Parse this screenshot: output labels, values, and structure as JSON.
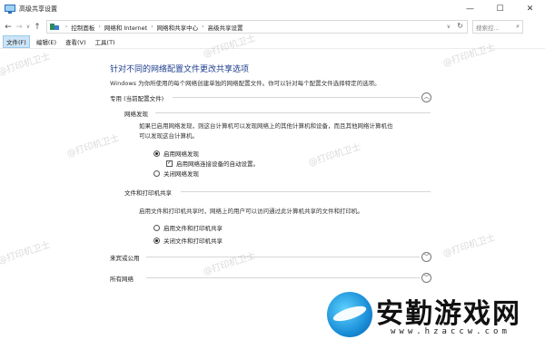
{
  "window": {
    "title": "高级共享设置",
    "controls": {
      "minimize": "—",
      "maximize": "☐",
      "close": "✕"
    }
  },
  "address_bar": {
    "back": "←",
    "forward": "→",
    "dropdown": "∨",
    "up": "↑",
    "crumbs": [
      "控制面板",
      "网络和 Internet",
      "网络和共享中心",
      "高级共享设置"
    ],
    "separator": "›",
    "refresh": "↻",
    "search_placeholder": "搜索控...",
    "search_icon": "⌕"
  },
  "menu": [
    "文件(F)",
    "编辑(E)",
    "查看(V)",
    "工具(T)"
  ],
  "main": {
    "title": "针对不同的网络配置文件更改共享选项",
    "description": "Windows 为你所使用的每个网络创建单独的网络配置文件。你可以针对每个配置文件选择特定的选项。"
  },
  "profiles": [
    {
      "label": "专用 (当前配置文件)",
      "expanded": true,
      "chevron": "︿"
    },
    {
      "label": "来宾或公用",
      "expanded": false,
      "chevron": "﹀"
    },
    {
      "label": "所有网络",
      "expanded": false,
      "chevron": "﹀"
    }
  ],
  "network_discovery": {
    "heading": "网络发现",
    "line1": "如果已启用网络发现，则这台计算机可以发现网络上的其他计算机和设备，而且其他网络计算机也",
    "line2": "可以发现这台计算机。",
    "options": [
      {
        "label": "启用网络发现",
        "selected": true
      },
      {
        "label": "启用网络连接设备的自动设置。",
        "checked": true,
        "check_mark": "✓"
      },
      {
        "label": "关闭网络发现",
        "selected": false
      }
    ]
  },
  "file_sharing": {
    "heading": "文件和打印机共享",
    "line1": "启用文件和打印机共享时，网络上的用户可以访问通过此计算机共享的文件和打印机。",
    "options": [
      {
        "label": "启用文件和打印机共享",
        "selected": false
      },
      {
        "label": "关闭文件和打印机共享",
        "selected": true
      }
    ]
  },
  "watermark": "@打印机卫士",
  "site_logo": {
    "brand": "安勤游戏网",
    "url": "www.hzaccw.com"
  },
  "colors": {
    "title_blue": "#1c3d8c",
    "menu_active_bg": "#cce4f7",
    "logo_blue": "#1a8fd8"
  }
}
